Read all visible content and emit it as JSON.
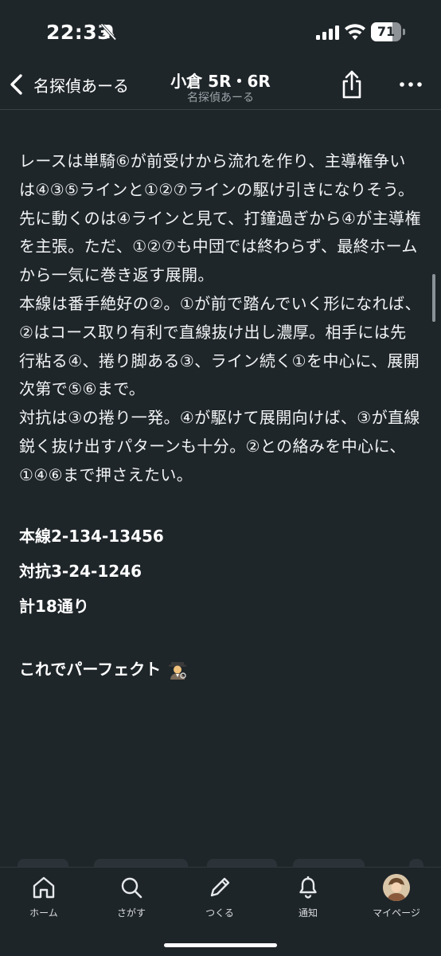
{
  "status_bar": {
    "time": "22:33",
    "battery_level": "71",
    "battery_fraction": 0.71
  },
  "nav": {
    "back_label": "名探偵あーる",
    "title": "小倉 5R・6R",
    "subtitle": "名探偵あーる"
  },
  "article": {
    "paragraphs": [
      "レースは単騎⑥が前受けから流れを作り、主導権争いは④③⑤ラインと①②⑦ラインの駆け引きになりそう。先に動くのは④ラインと見て、打鐘過ぎから④が主導権を主張。ただ、①②⑦も中団では終わらず、最終ホームから一気に巻き返す展開。",
      "本線は番手絶好の②。①が前で踏んでいく形になれば、②はコース取り有利で直線抜け出し濃厚。相手には先行粘る④、捲り脚ある③、ライン続く①を中心に、展開次第で⑤⑥まで。",
      "対抗は③の捲り一発。④が駆けて展開向けば、③が直線鋭く抜け出すパターンも十分。②との絡みを中心に、①④⑥まで押さえたい。"
    ],
    "picks": {
      "main": "本線2-134-13456",
      "counter": "対抗3-24-1246",
      "total": "計18通り"
    },
    "closing": "これでパーフェクト"
  },
  "tabs": [
    {
      "label": "ホーム",
      "icon": "home-icon"
    },
    {
      "label": "さがす",
      "icon": "search-icon"
    },
    {
      "label": "つくる",
      "icon": "pencil-icon"
    },
    {
      "label": "通知",
      "icon": "bell-icon"
    },
    {
      "label": "マイページ",
      "icon": "avatar"
    }
  ],
  "colors": {
    "background": "#1f262a",
    "text": "#ffffff",
    "muted": "#9aa3a8"
  }
}
